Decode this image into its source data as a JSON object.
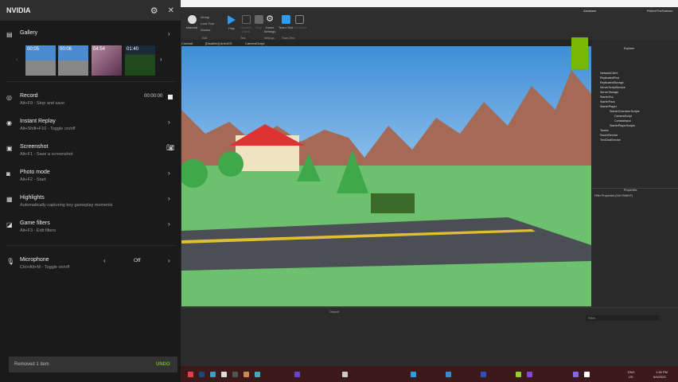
{
  "nvidia": {
    "title": "NVIDIA",
    "settings_icon": "gear-icon",
    "close_icon": "close-icon",
    "gallery": {
      "label": "Gallery",
      "thumbnails": [
        "00:05",
        "00:06",
        "04:54",
        "01:40"
      ]
    },
    "items": [
      {
        "label": "Record",
        "sub": "Alt+F9 - Stop and save",
        "value": "00:00:00"
      },
      {
        "label": "Instant Replay",
        "sub": "Alt+Shift+F10 - Toggle on/off"
      },
      {
        "label": "Screenshot",
        "sub": "Alt+F1 - Save a screenshot"
      },
      {
        "label": "Photo mode",
        "sub": "Alt+F2 - Start"
      },
      {
        "label": "Highlights",
        "sub": "Automatically capturing key gameplay moments"
      },
      {
        "label": "Game filters",
        "sub": "Alt+F3 - Edit filters"
      }
    ],
    "microphone": {
      "label": "Microphone",
      "sub": "Ctrl+Alt+M - Toggle on/off",
      "value": "Off"
    },
    "toast": {
      "message": "Removed 1 item",
      "action": "UNDO",
      "accent": "#76b900"
    }
  },
  "studio": {
    "toolbar": {
      "items": [
        "Material",
        "Lock Tool",
        "Play",
        "Current Client",
        "Stop",
        "Game Settings",
        "Team Test",
        "Exit Game"
      ],
      "groups": [
        "Edit",
        "Test",
        "Settings",
        "Team Test"
      ],
      "small": [
        "Group",
        "Anchor"
      ]
    },
    "topbar": {
      "assistant": "Assistant",
      "user": "RobertTheSalmon"
    },
    "tabs": [
      "Combat",
      "[Disabled] AnimGS",
      "CameraScript"
    ],
    "explorer": {
      "title": "Explorer",
      "items": [
        "NetworkClient",
        "ReplicatedFirst",
        "ReplicatedStorage",
        "ServerScriptService",
        "ServerStorage",
        "StarterGui",
        "StarterPack",
        "StarterPlayer",
        "StarterCharacterScripts",
        "CameraScript",
        "CombatInput",
        "StarterPlayerScripts",
        "Teams",
        "SoundService",
        "TextChatService"
      ]
    },
    "properties": {
      "title": "Properties",
      "filter": "Filter Properties (Ctrl+Shift+P)"
    },
    "output": {
      "title": "Output",
      "filter": "Filter..."
    }
  },
  "taskbar": {
    "lang": "ENG",
    "region": "US",
    "time": "1:46 PM",
    "date": "6/9/2025"
  }
}
